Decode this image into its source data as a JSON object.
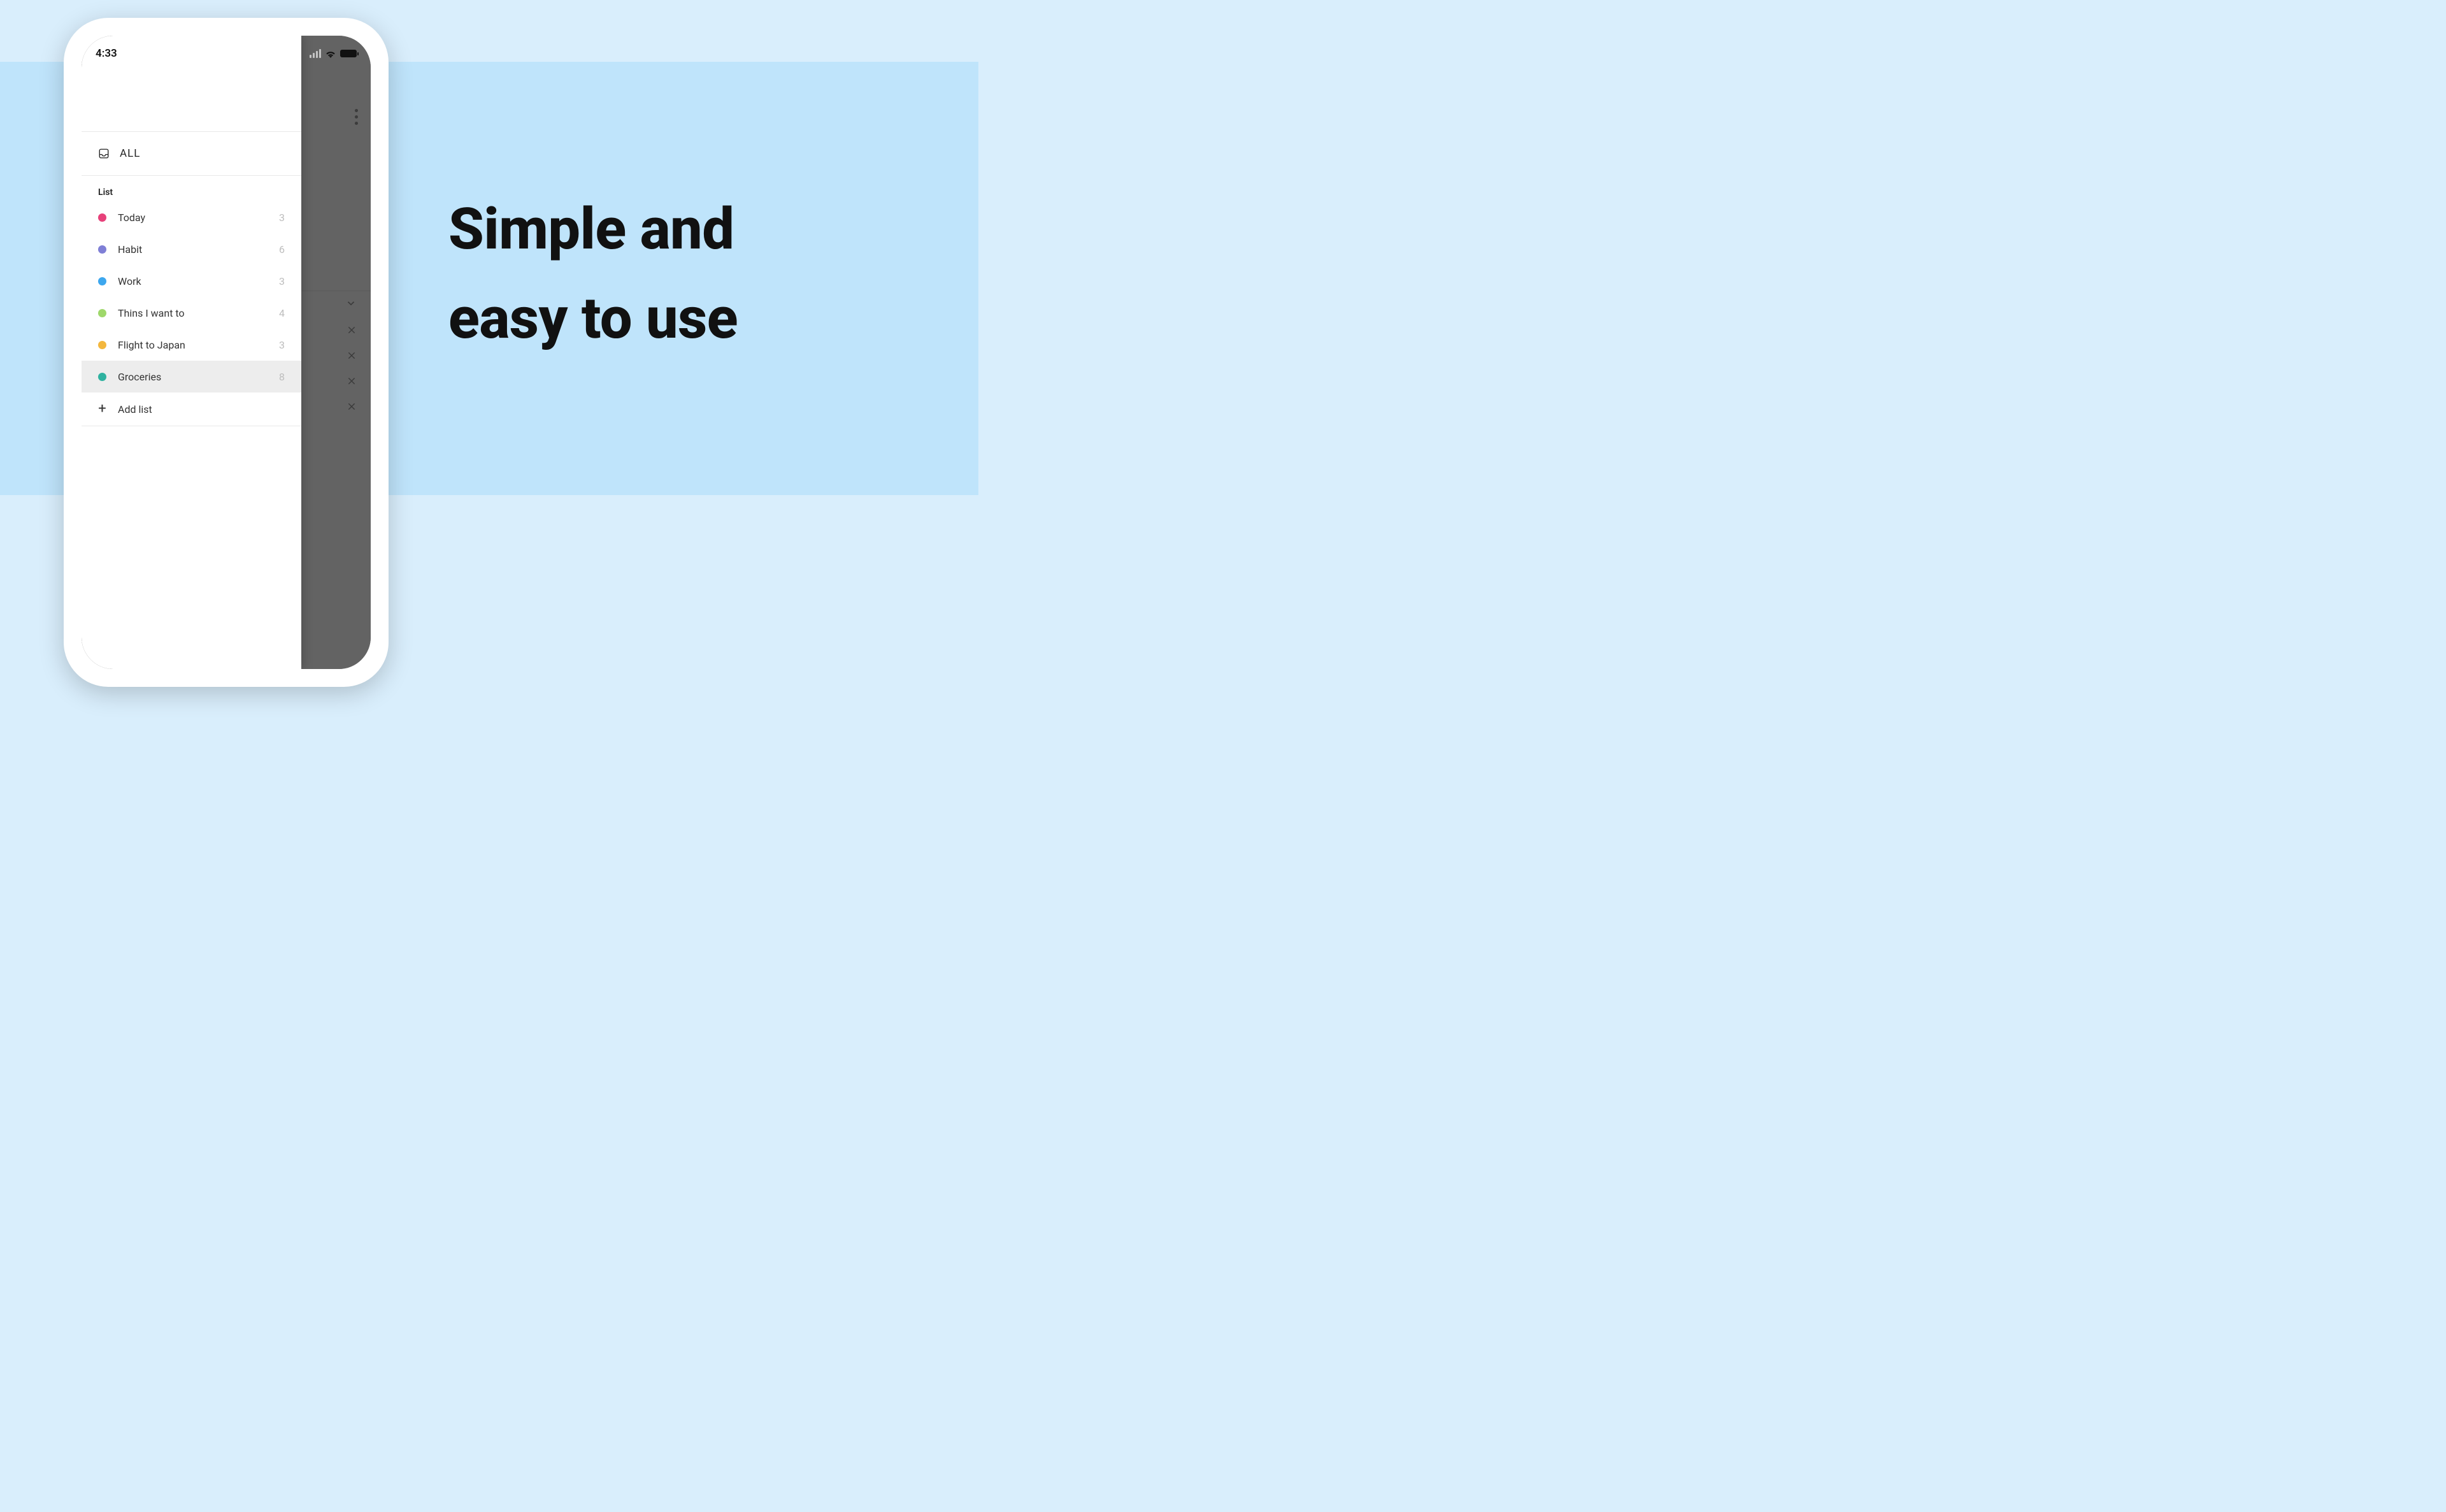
{
  "marketing": {
    "headline_line1": "Simple and",
    "headline_line2": "easy to use"
  },
  "statusbar": {
    "time": "4:33"
  },
  "drawer": {
    "all_label": "ALL",
    "section_label": "List",
    "add_label": "Add list",
    "lists": [
      {
        "name": "Today",
        "count": "3",
        "color": "#e7417a",
        "selected": false
      },
      {
        "name": "Habit",
        "count": "6",
        "color": "#7f7fd6",
        "selected": false
      },
      {
        "name": "Work",
        "count": "3",
        "color": "#3da7ee",
        "selected": false
      },
      {
        "name": "Thins I want to",
        "count": "4",
        "color": "#9fd86b",
        "selected": false
      },
      {
        "name": "Flight to Japan",
        "count": "3",
        "color": "#f3b73e",
        "selected": false
      },
      {
        "name": "Groceries",
        "count": "8",
        "color": "#2fb2a0",
        "selected": true
      }
    ]
  },
  "backdrop": {
    "row_icons": [
      "chevron",
      "x",
      "x",
      "x",
      "x"
    ]
  }
}
